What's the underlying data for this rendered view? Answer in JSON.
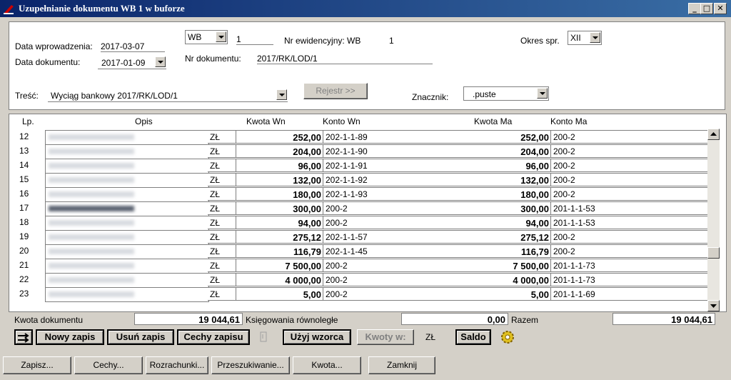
{
  "window": {
    "title": "Uzupełnianie dokumentu WB 1 w buforze",
    "minimize": "_",
    "restore": "□",
    "close": "✕"
  },
  "header": {
    "data_wprowadzenia_label": "Data wprowadzenia:",
    "data_wprowadzenia": "2017-03-07",
    "data_dokumentu_label": "Data dokumentu:",
    "data_dokumentu": "2017-01-09",
    "typ": "WB",
    "numer": "1",
    "nr_ewidencyjny_label": "Nr ewidencyjny: WB",
    "nr_ewidencyjny": "1",
    "okres_label": "Okres spr.",
    "okres": "XII",
    "nr_dokumentu_label": "Nr dokumentu:",
    "nr_dokumentu": "2017/RK/LOD/1",
    "tresc_label": "Treść:",
    "tresc": "Wyciąg bankowy 2017/RK/LOD/1",
    "rejestr_button": "Rejestr >>",
    "znacznik_label": "Znacznik:",
    "znacznik": ".puste"
  },
  "grid": {
    "columns": [
      "Lp.",
      "Opis",
      "Kwota Wn",
      "Konto Wn",
      "Kwota Ma",
      "Konto Ma"
    ],
    "rows": [
      {
        "lp": "12",
        "waluta": "ZŁ",
        "kwota_wn": "252,00",
        "konto_wn": "202-1-1-89",
        "kwota_ma": "252,00",
        "konto_ma": "200-2"
      },
      {
        "lp": "13",
        "waluta": "ZŁ",
        "kwota_wn": "204,00",
        "konto_wn": "202-1-1-90",
        "kwota_ma": "204,00",
        "konto_ma": "200-2"
      },
      {
        "lp": "14",
        "waluta": "ZŁ",
        "kwota_wn": "96,00",
        "konto_wn": "202-1-1-91",
        "kwota_ma": "96,00",
        "konto_ma": "200-2"
      },
      {
        "lp": "15",
        "waluta": "ZŁ",
        "kwota_wn": "132,00",
        "konto_wn": "202-1-1-92",
        "kwota_ma": "132,00",
        "konto_ma": "200-2"
      },
      {
        "lp": "16",
        "waluta": "ZŁ",
        "kwota_wn": "180,00",
        "konto_wn": "202-1-1-93",
        "kwota_ma": "180,00",
        "konto_ma": "200-2"
      },
      {
        "lp": "17",
        "waluta": "ZŁ",
        "kwota_wn": "300,00",
        "konto_wn": "200-2",
        "kwota_ma": "300,00",
        "konto_ma": "201-1-1-53"
      },
      {
        "lp": "18",
        "waluta": "ZŁ",
        "kwota_wn": "94,00",
        "konto_wn": "200-2",
        "kwota_ma": "94,00",
        "konto_ma": "201-1-1-53"
      },
      {
        "lp": "19",
        "waluta": "ZŁ",
        "kwota_wn": "275,12",
        "konto_wn": "202-1-1-57",
        "kwota_ma": "275,12",
        "konto_ma": "200-2"
      },
      {
        "lp": "20",
        "waluta": "ZŁ",
        "kwota_wn": "116,79",
        "konto_wn": "202-1-1-45",
        "kwota_ma": "116,79",
        "konto_ma": "200-2"
      },
      {
        "lp": "21",
        "waluta": "ZŁ",
        "kwota_wn": "7 500,00",
        "konto_wn": "200-2",
        "kwota_ma": "7 500,00",
        "konto_ma": "201-1-1-73"
      },
      {
        "lp": "22",
        "waluta": "ZŁ",
        "kwota_wn": "4 000,00",
        "konto_wn": "200-2",
        "kwota_ma": "4 000,00",
        "konto_ma": "201-1-1-73"
      },
      {
        "lp": "23",
        "waluta": "ZŁ",
        "kwota_wn": "5,00",
        "konto_wn": "200-2",
        "kwota_ma": "5,00",
        "konto_ma": "201-1-1-69"
      }
    ]
  },
  "summary": {
    "kwota_dokumentu_label": "Kwota dokumentu",
    "kwota_dokumentu": "19 044,61",
    "ksiegowania_label": "Księgowania równoległe",
    "ksiegowania": "0,00",
    "razem_label": "Razem",
    "razem": "19 044,61"
  },
  "toolbar": {
    "nowy_zapis": "Nowy zapis",
    "usun_zapis": "Usuń zapis",
    "cechy_zapisu": "Cechy zapisu",
    "uzyj_wzorca": "Użyj wzorca",
    "kwoty_w": "Kwoty w:",
    "waluta": "ZŁ",
    "saldo": "Saldo"
  },
  "bottom": {
    "zapisz": "Zapisz...",
    "cechy": "Cechy...",
    "rozrachunki": "Rozrachunki...",
    "przeszukiwanie": "Przeszukiwanie...",
    "kwota": "Kwota...",
    "zamknij": "Zamknij"
  }
}
